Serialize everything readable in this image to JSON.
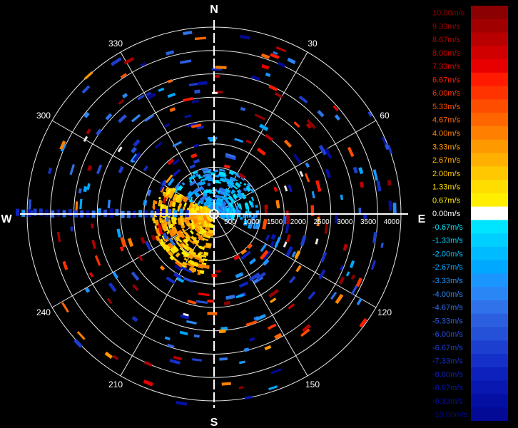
{
  "chart_data": {
    "type": "polar-heatmap",
    "cardinals": [
      "N",
      "E",
      "S",
      "W"
    ],
    "bearings": [
      "30",
      "60",
      "120",
      "150",
      "210",
      "240",
      "300",
      "330"
    ],
    "range_rings": [
      "500",
      "1000",
      "1500",
      "2000",
      "2500",
      "3000",
      "3500",
      "4000"
    ],
    "rmax": 4000,
    "legend": {
      "labels": [
        "10.00m/s",
        "9.33m/s",
        "8.67m/s",
        "8.00m/s",
        "7.33m/s",
        "6.67m/s",
        "6.00m/s",
        "5.33m/s",
        "4.67m/s",
        "4.00m/s",
        "3.33m/s",
        "2.67m/s",
        "2.00m/s",
        "1.33m/s",
        "0.67m/s",
        "0.00m/s",
        "-0.67m/s",
        "-1.33m/s",
        "-2.00m/s",
        "-2.67m/s",
        "-3.33m/s",
        "-4.00m/s",
        "-4.67m/s",
        "-5.33m/s",
        "-6.00m/s",
        "-6.67m/s",
        "-7.33m/s",
        "-8.00m/s",
        "-8.67m/s",
        "-9.33m/s",
        "-10.00m/s"
      ],
      "colors": [
        "#8b0000",
        "#a00000",
        "#b80000",
        "#d00000",
        "#e80000",
        "#ff1a00",
        "#ff3300",
        "#ff4d00",
        "#ff6600",
        "#ff8000",
        "#ff9900",
        "#ffb000",
        "#ffc800",
        "#ffdd00",
        "#ffee00",
        "#ffffff",
        "#00e5ff",
        "#00d0ff",
        "#00bbff",
        "#00a8ff",
        "#1c96ff",
        "#2b86f5",
        "#2f72ea",
        "#2c5fe0",
        "#2550d8",
        "#1c3fd0",
        "#1530c8",
        "#0d22bd",
        "#0818b0",
        "#0410a4",
        "#020a96"
      ]
    }
  }
}
